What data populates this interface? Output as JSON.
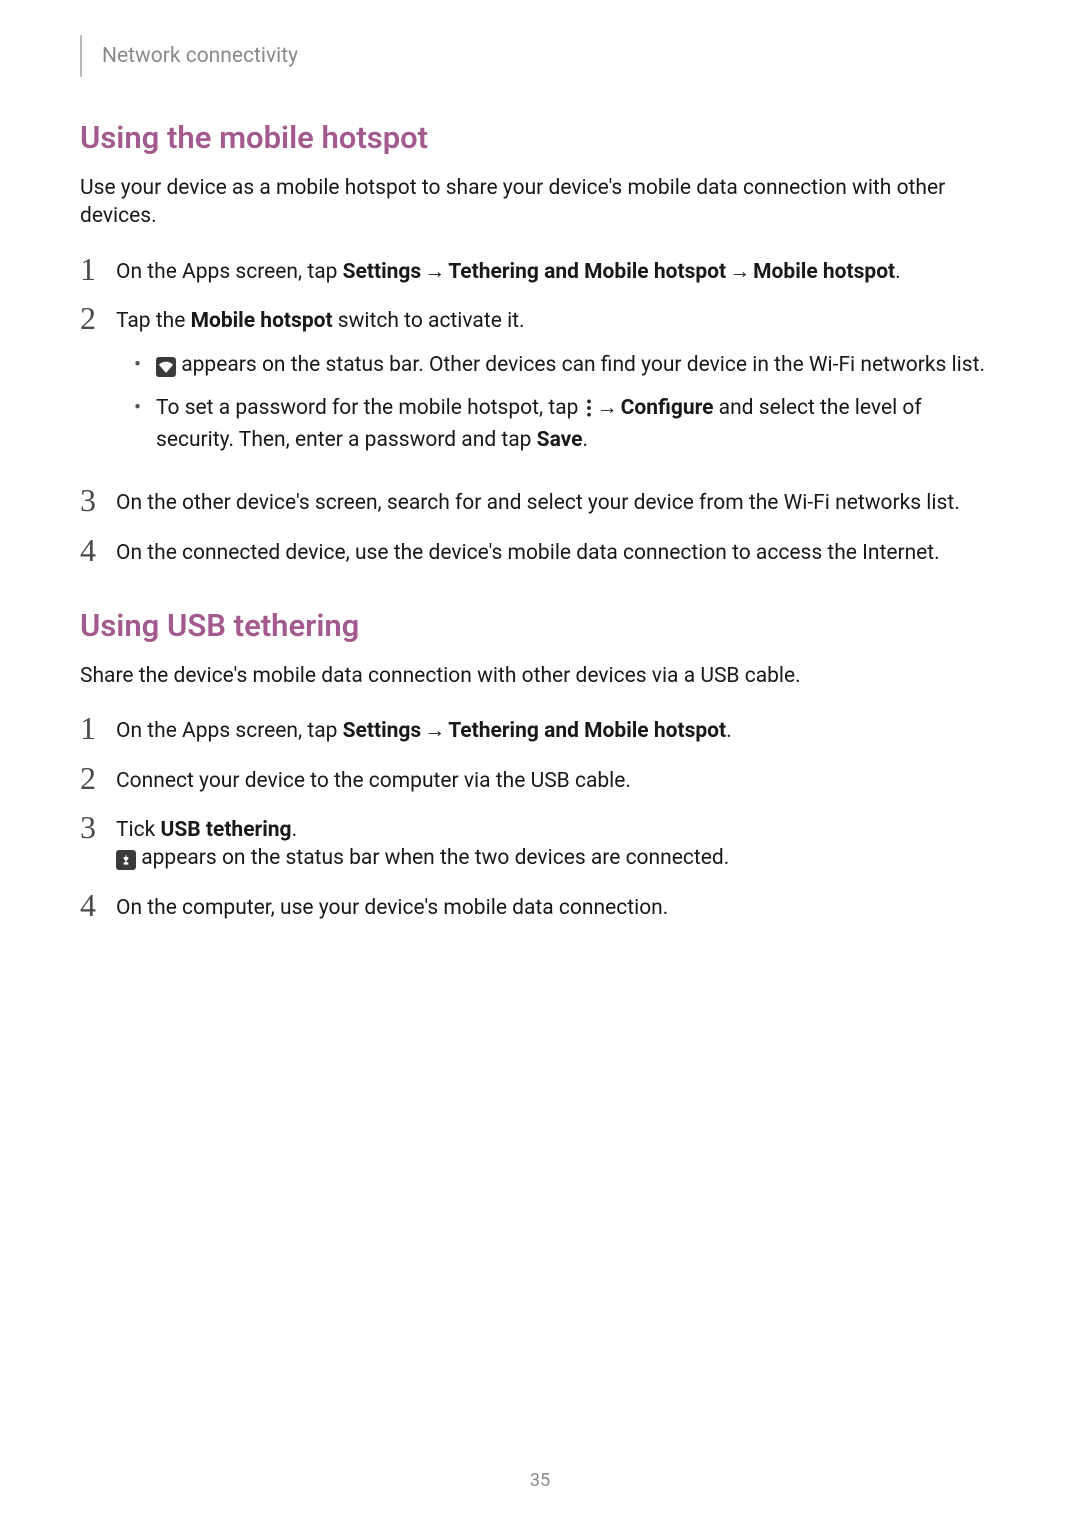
{
  "breadcrumb": "Network connectivity",
  "page_number": "35",
  "arrow": "→",
  "section_a": {
    "title": "Using the mobile hotspot",
    "intro": "Use your device as a mobile hotspot to share your device's mobile data connection with other devices.",
    "steps": {
      "s1": {
        "num": "1",
        "pre": "On the Apps screen, tap ",
        "b1": "Settings",
        "b2": "Tethering and Mobile hotspot",
        "b3": "Mobile hotspot",
        "dot": "."
      },
      "s2": {
        "num": "2",
        "pre": "Tap the ",
        "b1": "Mobile hotspot",
        "post": " switch to activate it.",
        "bullets": {
          "b1_post": " appears on the status bar. Other devices can find your device in the Wi-Fi networks list.",
          "b2_pre": "To set a password for the mobile hotspot, tap ",
          "b2_conf": "Configure",
          "b2_mid": " and select the level of security. Then, enter a password and tap ",
          "b2_save": "Save",
          "b2_dot": "."
        }
      },
      "s3": {
        "num": "3",
        "text": "On the other device's screen, search for and select your device from the Wi-Fi networks list."
      },
      "s4": {
        "num": "4",
        "text": "On the connected device, use the device's mobile data connection to access the Internet."
      }
    }
  },
  "section_b": {
    "title": "Using USB tethering",
    "intro": "Share the device's mobile data connection with other devices via a USB cable.",
    "steps": {
      "s1": {
        "num": "1",
        "pre": "On the Apps screen, tap ",
        "b1": "Settings",
        "b2": "Tethering and Mobile hotspot",
        "dot": "."
      },
      "s2": {
        "num": "2",
        "text": "Connect your device to the computer via the USB cable."
      },
      "s3": {
        "num": "3",
        "pre": "Tick ",
        "b1": "USB tethering",
        "dot": ".",
        "sub_post": " appears on the status bar when the two devices are connected."
      },
      "s4": {
        "num": "4",
        "text": "On the computer, use your device's mobile data connection."
      }
    }
  }
}
